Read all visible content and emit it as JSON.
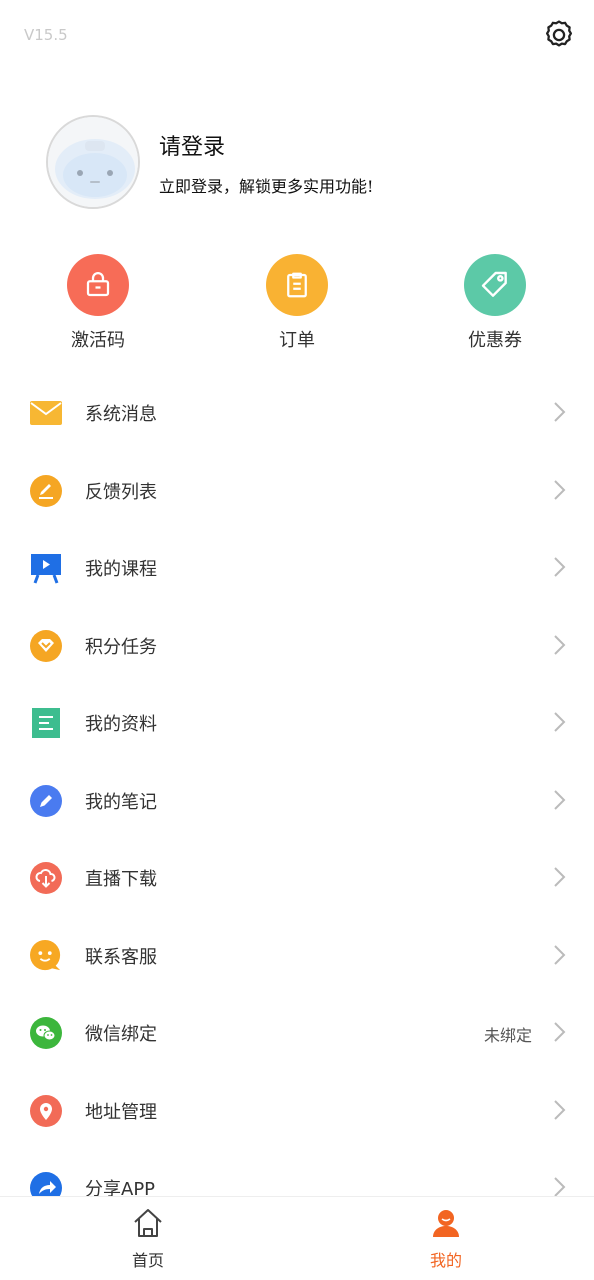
{
  "header": {
    "version": "V15.5",
    "settings_icon": "gear-icon"
  },
  "profile": {
    "title": "请登录",
    "subtitle": "立即登录，解锁更多实用功能!"
  },
  "quick_actions": [
    {
      "label": "激活码",
      "icon": "lock-bag-icon",
      "color": "#F76C57"
    },
    {
      "label": "订单",
      "icon": "clipboard-icon",
      "color": "#F9B233"
    },
    {
      "label": "优惠券",
      "icon": "tag-icon",
      "color": "#5CC9A7"
    }
  ],
  "menu": [
    {
      "label": "系统消息",
      "icon": "mail-icon",
      "color": "#F7B733",
      "value": ""
    },
    {
      "label": "反馈列表",
      "icon": "feedback-edit-icon",
      "color": "#F5A623",
      "value": ""
    },
    {
      "label": "我的课程",
      "icon": "course-board-icon",
      "color": "#1F6FE5",
      "value": ""
    },
    {
      "label": "积分任务",
      "icon": "points-heart-icon",
      "color": "#F5A623",
      "value": ""
    },
    {
      "label": "我的资料",
      "icon": "document-icon",
      "color": "#3DBD8F",
      "value": ""
    },
    {
      "label": "我的笔记",
      "icon": "pencil-icon",
      "color": "#4A7BF0",
      "value": ""
    },
    {
      "label": "直播下载",
      "icon": "cloud-download-icon",
      "color": "#F26B57",
      "value": ""
    },
    {
      "label": "联系客服",
      "icon": "smiley-chat-icon",
      "color": "#F7A823",
      "value": ""
    },
    {
      "label": "微信绑定",
      "icon": "wechat-icon",
      "color": "#3CB63C",
      "value": "未绑定"
    },
    {
      "label": "地址管理",
      "icon": "location-pin-icon",
      "color": "#F26B57",
      "value": ""
    },
    {
      "label": "分享APP",
      "icon": "share-icon",
      "color": "#1F6FE5",
      "value": ""
    }
  ],
  "tabbar": [
    {
      "label": "首页",
      "icon": "home-icon",
      "active": false
    },
    {
      "label": "我的",
      "icon": "user-icon",
      "active": true
    }
  ],
  "colors": {
    "accent": "#F26522",
    "chevron": "#BBBBBB"
  }
}
